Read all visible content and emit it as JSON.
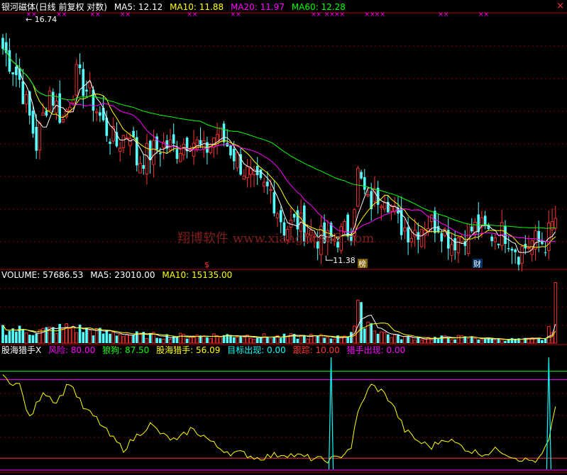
{
  "price_header": {
    "title": "银河磁体(日线 前复权 对数)",
    "items": [
      {
        "label": "MA5: 12.12",
        "color": "#ffffff"
      },
      {
        "label": "MA10: 11.88",
        "color": "#ffff00"
      },
      {
        "label": "MA20: 11.97",
        "color": "#ff00ff"
      },
      {
        "label": "MA60: 12.28",
        "color": "#00ff00"
      }
    ]
  },
  "close_icon": "×",
  "volume_header": {
    "items": [
      {
        "label": "VOLUME: 57686.53",
        "color": "#ffffff"
      },
      {
        "label": "MA5: 23010.00",
        "color": "#ffffff"
      },
      {
        "label": "MA10: 15135.00",
        "color": "#ffff00"
      }
    ]
  },
  "indicator_header": {
    "items": [
      {
        "label": "股海猎手X",
        "color": "#ffffff"
      },
      {
        "label": "风险: 80.00",
        "color": "#ff00ff"
      },
      {
        "label": "狼狗: 87.50",
        "color": "#00ff00"
      },
      {
        "label": "股海猎手: 56.09",
        "color": "#ffff00"
      },
      {
        "label": "目标出现: 0.00",
        "color": "#00ffff"
      },
      {
        "label": "跟踪: 10.00",
        "color": "#ff3333"
      },
      {
        "label": "猎手出现: 0.00",
        "color": "#ff00ff"
      }
    ]
  },
  "annotations": {
    "high_label": "16.74",
    "low_label": "11.38",
    "watermark": "翔博软件 www.xiangbosoft.com",
    "tag_bang": "榜",
    "tag_cai": "财",
    "tag_red": "$",
    "marker_symbol": "××"
  },
  "colors": {
    "up": "#ff3232",
    "down": "#54ffff",
    "ma5": "#ffffff",
    "ma10": "#ffff00",
    "ma20": "#ff00ff",
    "ma60": "#00ff00",
    "separator": "#b00000",
    "grid": "#880000"
  },
  "chart_data": [
    {
      "type": "candlestick",
      "title": "银河磁体(日线 前复权 对数)",
      "y_scale": "log",
      "ylim": [
        10.9,
        17.2
      ],
      "labels": {
        "max_price": 16.74,
        "min_price": 11.38
      },
      "series": {
        "anchors_close": [
          [
            0,
            16.2
          ],
          [
            5,
            15.3
          ],
          [
            10,
            13.6
          ],
          [
            14,
            15.0
          ],
          [
            18,
            14.2
          ],
          [
            22,
            15.4
          ],
          [
            26,
            14.9
          ],
          [
            30,
            14.1
          ],
          [
            34,
            13.6
          ],
          [
            38,
            14.0
          ],
          [
            40,
            13.2
          ],
          [
            44,
            13.4
          ],
          [
            48,
            13.6
          ],
          [
            52,
            13.5
          ],
          [
            56,
            13.8
          ],
          [
            60,
            13.4
          ],
          [
            64,
            13.9
          ],
          [
            68,
            13.5
          ],
          [
            72,
            13.0
          ],
          [
            76,
            12.6
          ],
          [
            80,
            12.5
          ],
          [
            84,
            11.7
          ],
          [
            88,
            11.8
          ],
          [
            92,
            11.6
          ],
          [
            96,
            11.4
          ],
          [
            100,
            11.5
          ],
          [
            104,
            11.7
          ],
          [
            106,
            12.9
          ],
          [
            109,
            12.2
          ],
          [
            112,
            12.4
          ],
          [
            114,
            12.5
          ],
          [
            118,
            11.8
          ],
          [
            122,
            11.6
          ],
          [
            126,
            11.8
          ],
          [
            130,
            11.8
          ],
          [
            134,
            11.4
          ],
          [
            138,
            11.6
          ],
          [
            142,
            11.7
          ],
          [
            146,
            11.55
          ],
          [
            150,
            11.6
          ],
          [
            154,
            11.2
          ],
          [
            158,
            11.4
          ],
          [
            162,
            11.4
          ],
          [
            165,
            11.9
          ]
        ]
      }
    },
    {
      "type": "bar",
      "title": "VOLUME",
      "series": {
        "anchors": [
          [
            0,
            14000
          ],
          [
            10,
            11000
          ],
          [
            20,
            15000
          ],
          [
            30,
            10000
          ],
          [
            40,
            8000
          ],
          [
            50,
            6500
          ],
          [
            60,
            7000
          ],
          [
            70,
            7500
          ],
          [
            80,
            6000
          ],
          [
            90,
            6500
          ],
          [
            100,
            5500
          ],
          [
            103,
            9000
          ],
          [
            105,
            16000
          ],
          [
            106,
            30000
          ],
          [
            108,
            25000
          ],
          [
            111,
            15000
          ],
          [
            114,
            9000
          ],
          [
            118,
            6000
          ],
          [
            125,
            4500
          ],
          [
            135,
            5500
          ],
          [
            145,
            4000
          ],
          [
            155,
            3500
          ],
          [
            162,
            4000
          ],
          [
            164,
            18000
          ],
          [
            165,
            57686.53
          ]
        ]
      },
      "ma5": 23010.0,
      "ma10": 15135.0
    },
    {
      "type": "line",
      "title": "股海猎手X",
      "ylim": [
        0,
        100
      ],
      "levels": {
        "风险": 80,
        "狼狗": 87.5,
        "跟踪": 10
      },
      "series": [
        {
          "name": "股海猎手",
          "anchors": [
            [
              0,
              82
            ],
            [
              5,
              75
            ],
            [
              8,
              45
            ],
            [
              12,
              70
            ],
            [
              16,
              60
            ],
            [
              20,
              78
            ],
            [
              24,
              55
            ],
            [
              28,
              45
            ],
            [
              32,
              30
            ],
            [
              36,
              18
            ],
            [
              40,
              30
            ],
            [
              44,
              40
            ],
            [
              48,
              30
            ],
            [
              52,
              25
            ],
            [
              56,
              36
            ],
            [
              60,
              30
            ],
            [
              64,
              20
            ],
            [
              68,
              15
            ],
            [
              72,
              14
            ],
            [
              76,
              10
            ],
            [
              80,
              12
            ],
            [
              84,
              14
            ],
            [
              88,
              12
            ],
            [
              92,
              10
            ],
            [
              96,
              8
            ],
            [
              100,
              10
            ],
            [
              104,
              20
            ],
            [
              106,
              50
            ],
            [
              108,
              65
            ],
            [
              110,
              75
            ],
            [
              113,
              70
            ],
            [
              116,
              60
            ],
            [
              120,
              35
            ],
            [
              124,
              25
            ],
            [
              128,
              20
            ],
            [
              132,
              28
            ],
            [
              136,
              22
            ],
            [
              140,
              16
            ],
            [
              144,
              14
            ],
            [
              148,
              18
            ],
            [
              152,
              12
            ],
            [
              156,
              8
            ],
            [
              160,
              8
            ],
            [
              163,
              25
            ],
            [
              165,
              56.09
            ]
          ]
        },
        {
          "name": "目标出现",
          "spikes_at": [
            98,
            163
          ],
          "spike_value": 100
        }
      ]
    }
  ]
}
